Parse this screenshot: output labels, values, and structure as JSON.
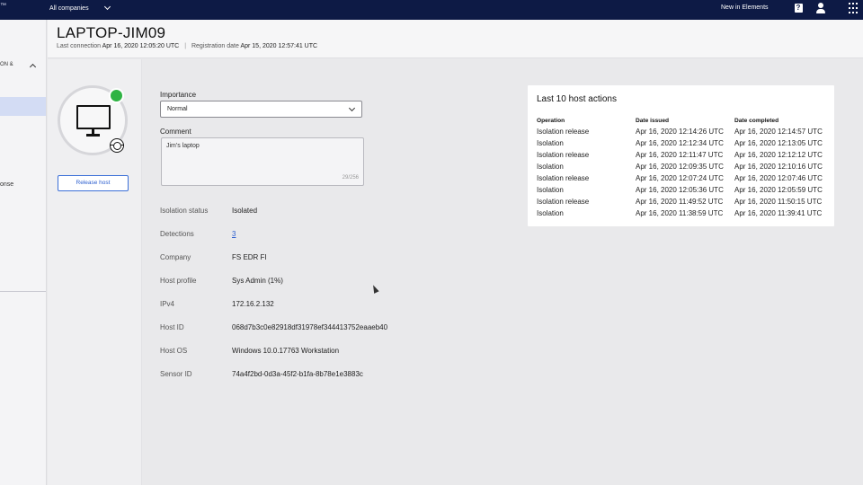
{
  "topbar": {
    "brand_fragment": "™",
    "company_select": "All companies",
    "new_in_elements": "New in Elements",
    "icons": [
      "help-icon",
      "user-icon",
      "apps-grid-icon"
    ]
  },
  "leftnav": {
    "group_label": "ON &",
    "response_label": "onse"
  },
  "host": {
    "name": "LAPTOP-JIM09",
    "last_connection_label": "Last connection",
    "last_connection": "Apr 16, 2020 12:05:20 UTC",
    "registration_label": "Registration date",
    "registration_date": "Apr 15, 2020 12:57:41 UTC",
    "status_color": "#2fb344"
  },
  "actions": {
    "release_host": "Release host"
  },
  "form": {
    "importance_label": "Importance",
    "importance_value": "Normal",
    "comment_label": "Comment",
    "comment_value": "Jim's laptop",
    "comment_counter": "29/256"
  },
  "details": [
    {
      "label": "Isolation status",
      "value": "Isolated"
    },
    {
      "label": "Detections",
      "value": "3"
    },
    {
      "label": "Company",
      "value": "FS EDR FI"
    },
    {
      "label": "Host profile",
      "value": "Sys Admin (1%)"
    },
    {
      "label": "IPv4",
      "value": "172.16.2.132"
    },
    {
      "label": "Host ID",
      "value": "068d7b3c0e82918df31978ef344413752eaaeb40"
    },
    {
      "label": "Host OS",
      "value": "Windows 10.0.17763 Workstation"
    },
    {
      "label": "Sensor ID",
      "value": "74a4f2bd-0d3a-45f2-b1fa-8b78e1e3883c"
    }
  ],
  "host_actions": {
    "title": "Last 10 host actions",
    "columns": [
      "Operation",
      "Date issued",
      "Date completed"
    ],
    "rows": [
      [
        "Isolation release",
        "Apr 16, 2020 12:14:26 UTC",
        "Apr 16, 2020 12:14:57 UTC"
      ],
      [
        "Isolation",
        "Apr 16, 2020 12:12:34 UTC",
        "Apr 16, 2020 12:13:05 UTC"
      ],
      [
        "Isolation release",
        "Apr 16, 2020 12:11:47 UTC",
        "Apr 16, 2020 12:12:12 UTC"
      ],
      [
        "Isolation",
        "Apr 16, 2020 12:09:35 UTC",
        "Apr 16, 2020 12:10:16 UTC"
      ],
      [
        "Isolation release",
        "Apr 16, 2020 12:07:24 UTC",
        "Apr 16, 2020 12:07:46 UTC"
      ],
      [
        "Isolation",
        "Apr 16, 2020 12:05:36 UTC",
        "Apr 16, 2020 12:05:59 UTC"
      ],
      [
        "Isolation release",
        "Apr 16, 2020 11:49:52 UTC",
        "Apr 16, 2020 11:50:15 UTC"
      ],
      [
        "Isolation",
        "Apr 16, 2020 11:38:59 UTC",
        "Apr 16, 2020 11:39:41 UTC"
      ]
    ]
  }
}
